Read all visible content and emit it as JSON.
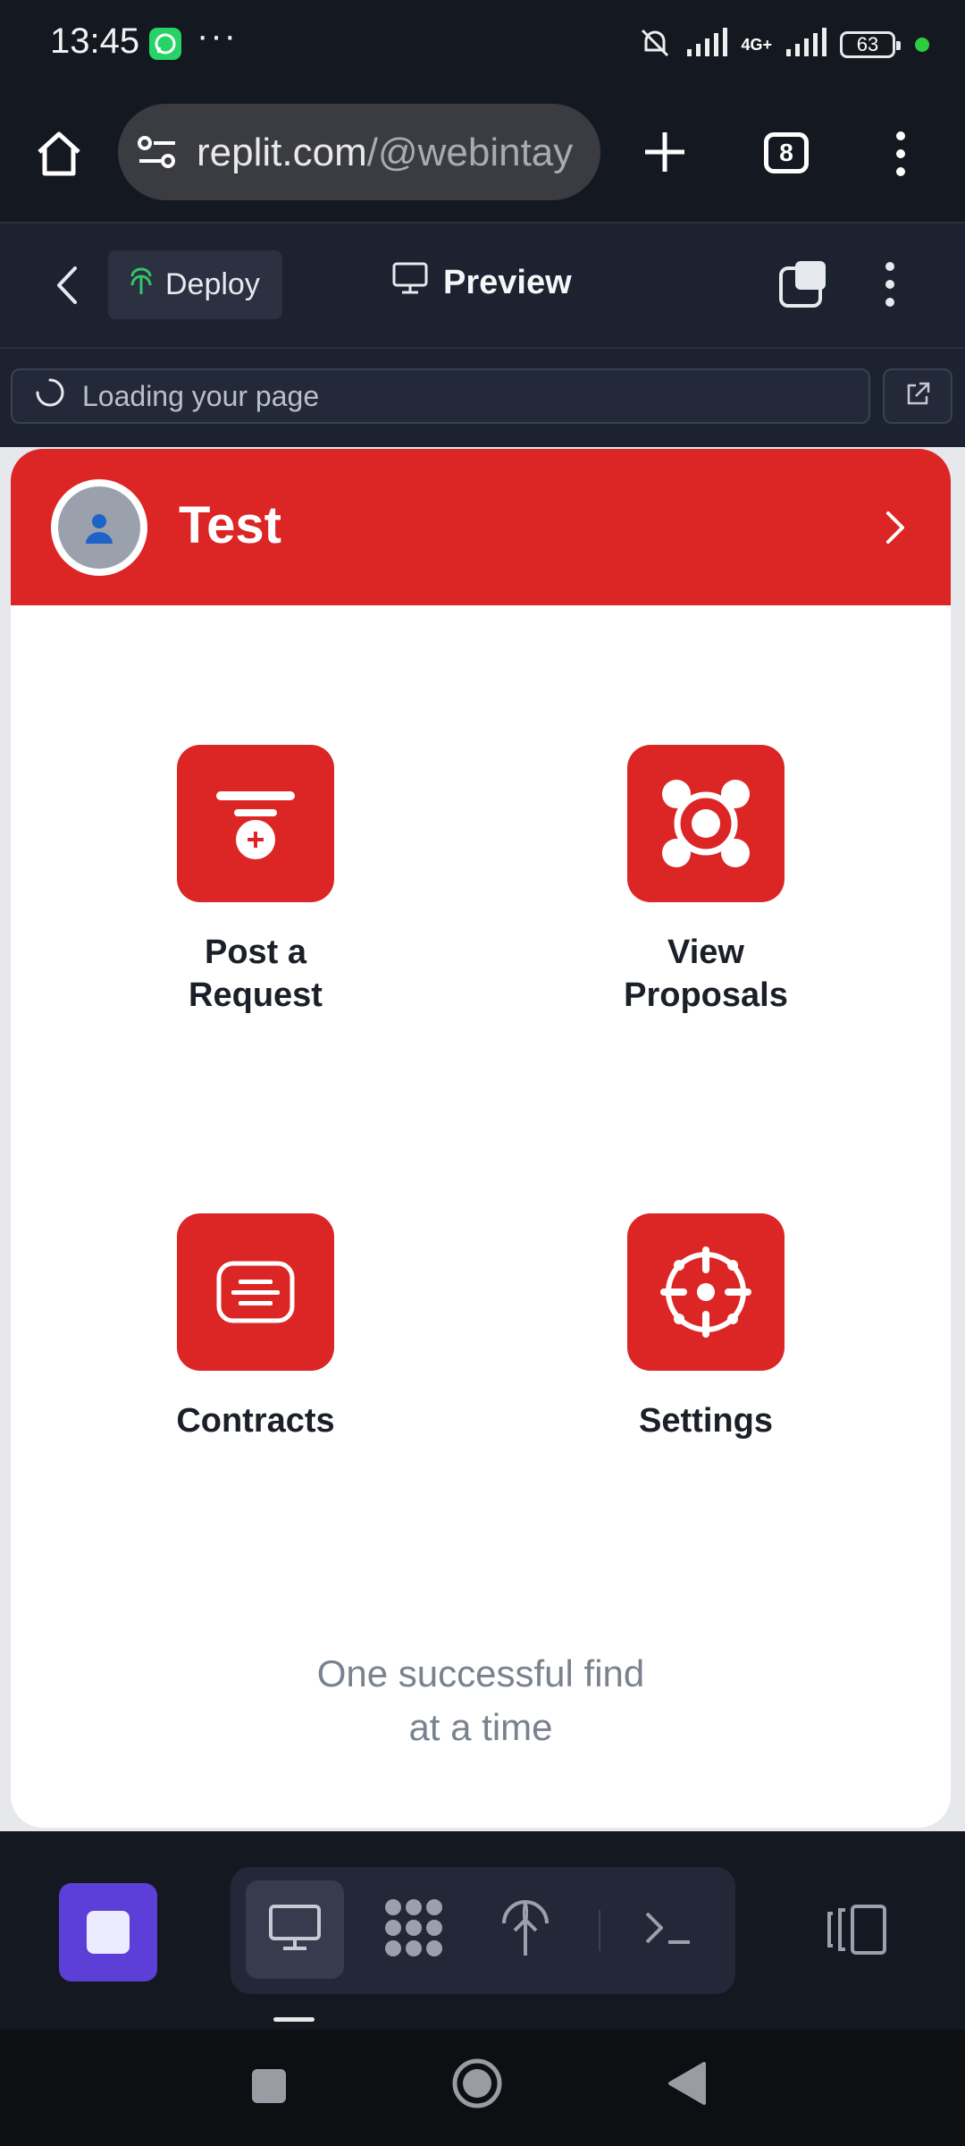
{
  "status_bar": {
    "time": "13:45",
    "notification_icons": [
      "whatsapp-icon",
      "more-dots-icon"
    ],
    "network": "4G+",
    "battery": "63"
  },
  "browser": {
    "url_host": "replit.com",
    "url_path": "/@webintay",
    "tab_count": "8"
  },
  "toolbar": {
    "deploy_label": "Deploy",
    "preview_label": "Preview"
  },
  "address": {
    "loading_text": "Loading your page"
  },
  "app": {
    "username": "Test",
    "tiles": [
      {
        "label_line1": "Post a",
        "label_line2": "Request",
        "icon": "post-request-icon"
      },
      {
        "label_line1": "View",
        "label_line2": "Proposals",
        "icon": "view-proposals-icon"
      },
      {
        "label_line1": "Contracts",
        "label_line2": "",
        "icon": "contracts-icon"
      },
      {
        "label_line1": "Settings",
        "label_line2": "",
        "icon": "settings-icon"
      }
    ],
    "tagline_line1": "One successful find",
    "tagline_line2": "at a time"
  },
  "colors": {
    "brand_red": "#dc2626",
    "replit_purple": "#5b3fd6",
    "dark_bg": "#141821"
  }
}
